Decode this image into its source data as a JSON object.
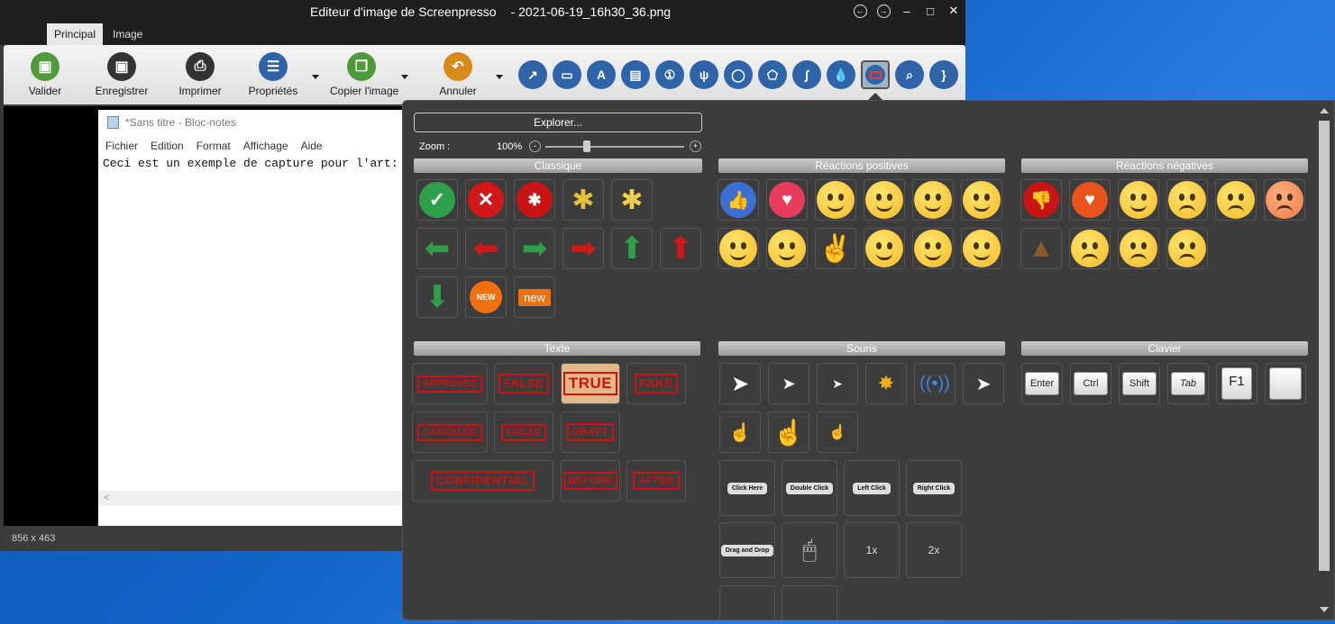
{
  "window": {
    "title": "Editeur d'image de Screenpresso",
    "filename": "- 2021-06-19_16h30_36.png",
    "status": "856 x 463"
  },
  "tabs": [
    {
      "label": "Principal"
    },
    {
      "label": "Image"
    }
  ],
  "ribbon": {
    "buttons": [
      {
        "label": "Valider",
        "color": "#4f9a3a",
        "icon": "save-icon"
      },
      {
        "label": "Enregistrer",
        "color": "#333333",
        "icon": "save-as-icon"
      },
      {
        "label": "Imprimer",
        "color": "#333333",
        "icon": "printer-icon"
      },
      {
        "label": "Propriétés",
        "color": "#2f65a8",
        "icon": "list-icon"
      },
      {
        "label": "Copier l'image",
        "color": "#4f9a3a",
        "icon": "copy-icon"
      },
      {
        "label": "Annuler",
        "color": "#d88a1a",
        "icon": "undo-icon"
      }
    ],
    "tools": [
      "arrow-tool-icon",
      "rectangle-tool-icon",
      "text-tool-icon",
      "callout-tool-icon",
      "step-tool-icon",
      "magnet-tool-icon",
      "ellipse-tool-icon",
      "polygon-tool-icon",
      "freehand-tool-icon",
      "blur-tool-icon",
      "stamp-tool-icon",
      "magnifier-tool-icon",
      "brace-tool-icon"
    ]
  },
  "notepad": {
    "title": "*Sans titre - Bloc-notes",
    "menu": [
      "Fichier",
      "Edition",
      "Format",
      "Affichage",
      "Aide"
    ],
    "text": "Ceci est un exemple de capture pour l'art:",
    "scroll_arrow": "<"
  },
  "panel": {
    "explore": "Explorer...",
    "zoom_label": "Zoom :",
    "zoom_value": "100%",
    "zoom_minus": "-",
    "zoom_plus": "+",
    "sections": {
      "classique": "Classique",
      "positives": "Réactions positives",
      "negatives": "Réactions négatives",
      "texte": "Texte",
      "souris": "Souris",
      "clavier": "Clavier"
    },
    "badges": {
      "new1": "NEW",
      "new2": "new"
    },
    "stamps": [
      "APPROVED",
      "FALSE",
      "TRUE",
      "FAKE",
      "CANCELED",
      "FAILED",
      "DRAFT",
      "CONFIDENTIAL",
      "BEFORE",
      "AFTER"
    ],
    "keys": [
      "Enter",
      "Ctrl",
      "Shift",
      "Tab",
      "F1"
    ],
    "balloons": [
      "Click Here",
      "Double Click",
      "Left Click",
      "Right Click",
      "Drag and Drop"
    ],
    "mouse_labels": [
      "1x",
      "2x"
    ]
  }
}
